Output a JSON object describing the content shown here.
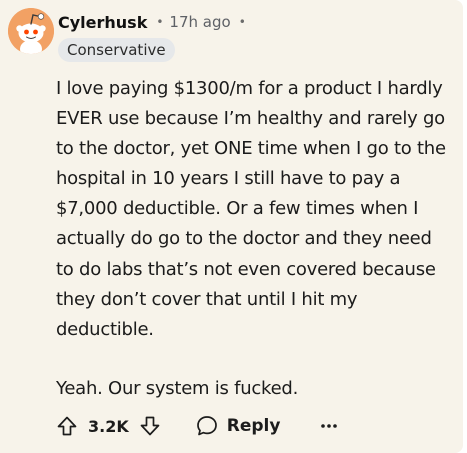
{
  "comment": {
    "username": "Cylerhusk",
    "separator": "•",
    "timestamp": "17h ago",
    "flair": "Conservative",
    "paragraphs": [
      "I love paying $1300/m for a product I hardly EVER use because I’m healthy and rarely go to the doctor, yet ONE time when I go to the hospital in 10 years I still have to pay a $7,000 deductible. Or a few times when I actually do go to the doctor and they need to do labs that’s not even covered because they don’t cover that until I hit my deductible.",
      "Yeah. Our system is fucked."
    ]
  },
  "actions": {
    "upvote_icon": "upvote-arrow-icon",
    "score": "3.2K",
    "downvote_icon": "downvote-arrow-icon",
    "reply_icon": "speech-bubble-icon",
    "reply_label": "Reply",
    "more_icon": "ellipsis-icon"
  },
  "colors": {
    "card_background": "#f7f3ea",
    "avatar_background": "#f2a164",
    "flair_background": "#e6e8ea",
    "text": "#1c1c1c",
    "muted_text": "#5e6166"
  }
}
